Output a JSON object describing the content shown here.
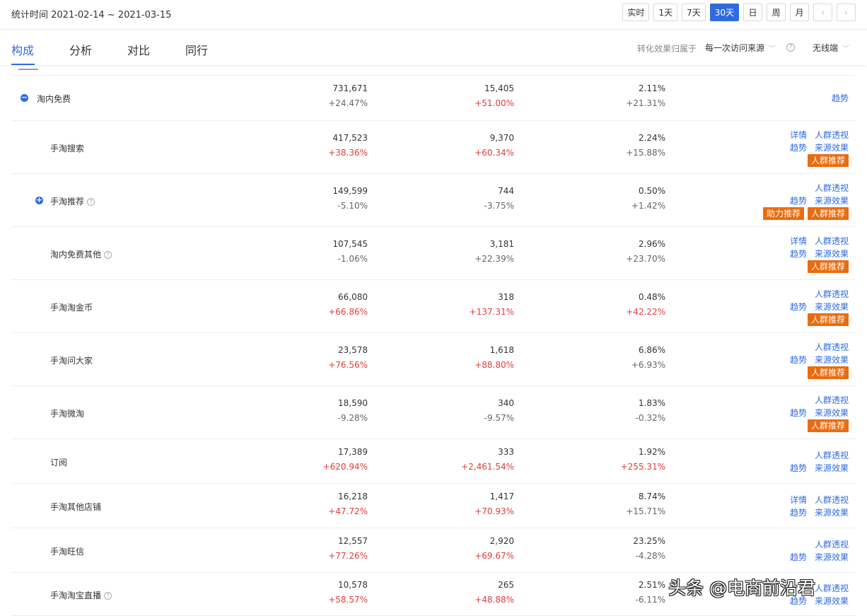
{
  "header": {
    "date_range": "统计时间 2021-02-14 ~ 2021-03-15",
    "range_buttons": [
      "实时",
      "1天",
      "7天",
      "30天",
      "日",
      "周",
      "月"
    ],
    "active_range": "30天",
    "prev_label": "‹",
    "next_label": "›"
  },
  "tabs": [
    "构成",
    "分析",
    "对比",
    "同行"
  ],
  "active_tab": "构成",
  "filters": {
    "attribution_label": "转化效果归属于",
    "attribution_value": "每一次访问来源",
    "device_value": "无线端"
  },
  "table": {
    "rows": [
      {
        "name": "淘内免费",
        "level": 0,
        "expand": "−",
        "help": false,
        "v1": "731,671",
        "c1": "+24.47%",
        "c1_up": false,
        "v2": "15,405",
        "c2": "+51.00%",
        "c2_up": true,
        "v3": "2.11%",
        "c3": "+21.31%",
        "c3_up": false,
        "links": [
          [
            "趋势"
          ]
        ],
        "badges": []
      },
      {
        "name": "手淘搜索",
        "level": 1,
        "expand": "",
        "help": false,
        "v1": "417,523",
        "c1": "+38.36%",
        "c1_up": true,
        "v2": "9,370",
        "c2": "+60.34%",
        "c2_up": true,
        "v3": "2.24%",
        "c3": "+15.88%",
        "c3_up": false,
        "links": [
          [
            "详情",
            "人群透视"
          ],
          [
            "趋势",
            "来源效果"
          ]
        ],
        "badges": [
          "人群推荐"
        ]
      },
      {
        "name": "手淘推荐",
        "level": 1,
        "expand": "+",
        "help": true,
        "v1": "149,599",
        "c1": "-5.10%",
        "c1_up": false,
        "v2": "744",
        "c2": "-3.75%",
        "c2_up": false,
        "v3": "0.50%",
        "c3": "+1.42%",
        "c3_up": false,
        "links": [
          [
            "人群透视"
          ],
          [
            "趋势",
            "来源效果"
          ]
        ],
        "badges": [
          "助力推荐",
          "人群推荐"
        ]
      },
      {
        "name": "淘内免费其他",
        "level": 1,
        "expand": "",
        "help": true,
        "v1": "107,545",
        "c1": "-1.06%",
        "c1_up": false,
        "v2": "3,181",
        "c2": "+22.39%",
        "c2_up": false,
        "v3": "2.96%",
        "c3": "+23.70%",
        "c3_up": false,
        "links": [
          [
            "详情",
            "人群透视"
          ],
          [
            "趋势",
            "来源效果"
          ]
        ],
        "badges": [
          "人群推荐"
        ]
      },
      {
        "name": "手淘淘金币",
        "level": 1,
        "expand": "",
        "help": false,
        "v1": "66,080",
        "c1": "+66.86%",
        "c1_up": true,
        "v2": "318",
        "c2": "+137.31%",
        "c2_up": true,
        "v3": "0.48%",
        "c3": "+42.22%",
        "c3_up": true,
        "links": [
          [
            "人群透视"
          ],
          [
            "趋势",
            "来源效果"
          ]
        ],
        "badges": [
          "人群推荐"
        ]
      },
      {
        "name": "手淘问大家",
        "level": 1,
        "expand": "",
        "help": false,
        "v1": "23,578",
        "c1": "+76.56%",
        "c1_up": true,
        "v2": "1,618",
        "c2": "+88.80%",
        "c2_up": true,
        "v3": "6.86%",
        "c3": "+6.93%",
        "c3_up": false,
        "links": [
          [
            "人群透视"
          ],
          [
            "趋势",
            "来源效果"
          ]
        ],
        "badges": [
          "人群推荐"
        ]
      },
      {
        "name": "手淘微淘",
        "level": 1,
        "expand": "",
        "help": false,
        "v1": "18,590",
        "c1": "-9.28%",
        "c1_up": false,
        "v2": "340",
        "c2": "-9.57%",
        "c2_up": false,
        "v3": "1.83%",
        "c3": "-0.32%",
        "c3_up": false,
        "links": [
          [
            "人群透视"
          ],
          [
            "趋势",
            "来源效果"
          ]
        ],
        "badges": [
          "人群推荐"
        ]
      },
      {
        "name": "订阅",
        "level": 1,
        "expand": "",
        "help": false,
        "v1": "17,389",
        "c1": "+620.94%",
        "c1_up": true,
        "v2": "333",
        "c2": "+2,461.54%",
        "c2_up": true,
        "v3": "1.92%",
        "c3": "+255.31%",
        "c3_up": true,
        "links": [
          [
            "人群透视"
          ],
          [
            "趋势",
            "来源效果"
          ]
        ],
        "badges": []
      },
      {
        "name": "手淘其他店铺",
        "level": 1,
        "expand": "",
        "help": false,
        "v1": "16,218",
        "c1": "+47.72%",
        "c1_up": true,
        "v2": "1,417",
        "c2": "+70.93%",
        "c2_up": true,
        "v3": "8.74%",
        "c3": "+15.71%",
        "c3_up": false,
        "links": [
          [
            "详情",
            "人群透视"
          ],
          [
            "趋势",
            "来源效果"
          ]
        ],
        "badges": []
      },
      {
        "name": "手淘旺信",
        "level": 1,
        "expand": "",
        "help": false,
        "v1": "12,557",
        "c1": "+77.26%",
        "c1_up": true,
        "v2": "2,920",
        "c2": "+69.67%",
        "c2_up": true,
        "v3": "23.25%",
        "c3": "-4.28%",
        "c3_up": false,
        "links": [
          [
            "人群透视"
          ],
          [
            "趋势",
            "来源效果"
          ]
        ],
        "badges": []
      },
      {
        "name": "手淘淘宝直播",
        "level": 1,
        "expand": "",
        "help": true,
        "v1": "10,578",
        "c1": "+58.57%",
        "c1_up": true,
        "v2": "265",
        "c2": "+48.88%",
        "c2_up": true,
        "v3": "2.51%",
        "c3": "-6.11%",
        "c3_up": false,
        "links": [
          [
            "人群透视"
          ],
          [
            "趋势",
            "来源效果"
          ]
        ],
        "badges": []
      }
    ]
  },
  "watermark": "头条 @电商前沿君"
}
